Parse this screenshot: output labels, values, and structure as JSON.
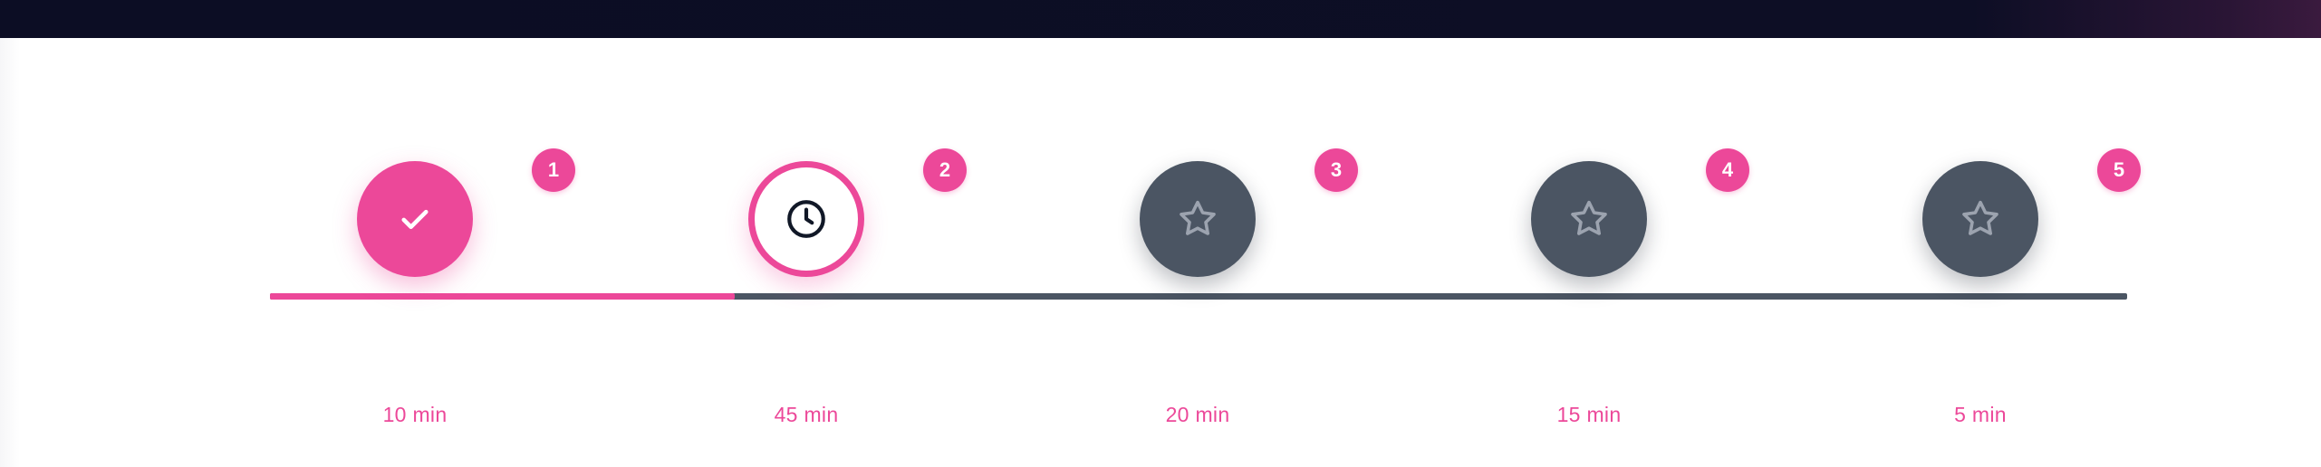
{
  "progress": {
    "completed_fraction": 0.25,
    "current_step": 2
  },
  "colors": {
    "accent": "#ec4899",
    "upcoming": "#4b5563",
    "upcoming_icon": "#9ca3af",
    "track": "#4b5563",
    "header_bg": "#0c0d24"
  },
  "steps": [
    {
      "number": "1",
      "duration": "10 min",
      "status": "done",
      "icon": "check-icon"
    },
    {
      "number": "2",
      "duration": "45 min",
      "status": "current",
      "icon": "clock-icon"
    },
    {
      "number": "3",
      "duration": "20 min",
      "status": "upcoming",
      "icon": "star-icon"
    },
    {
      "number": "4",
      "duration": "15 min",
      "status": "upcoming",
      "icon": "star-icon"
    },
    {
      "number": "5",
      "duration": "5 min",
      "status": "upcoming",
      "icon": "star-icon"
    }
  ]
}
